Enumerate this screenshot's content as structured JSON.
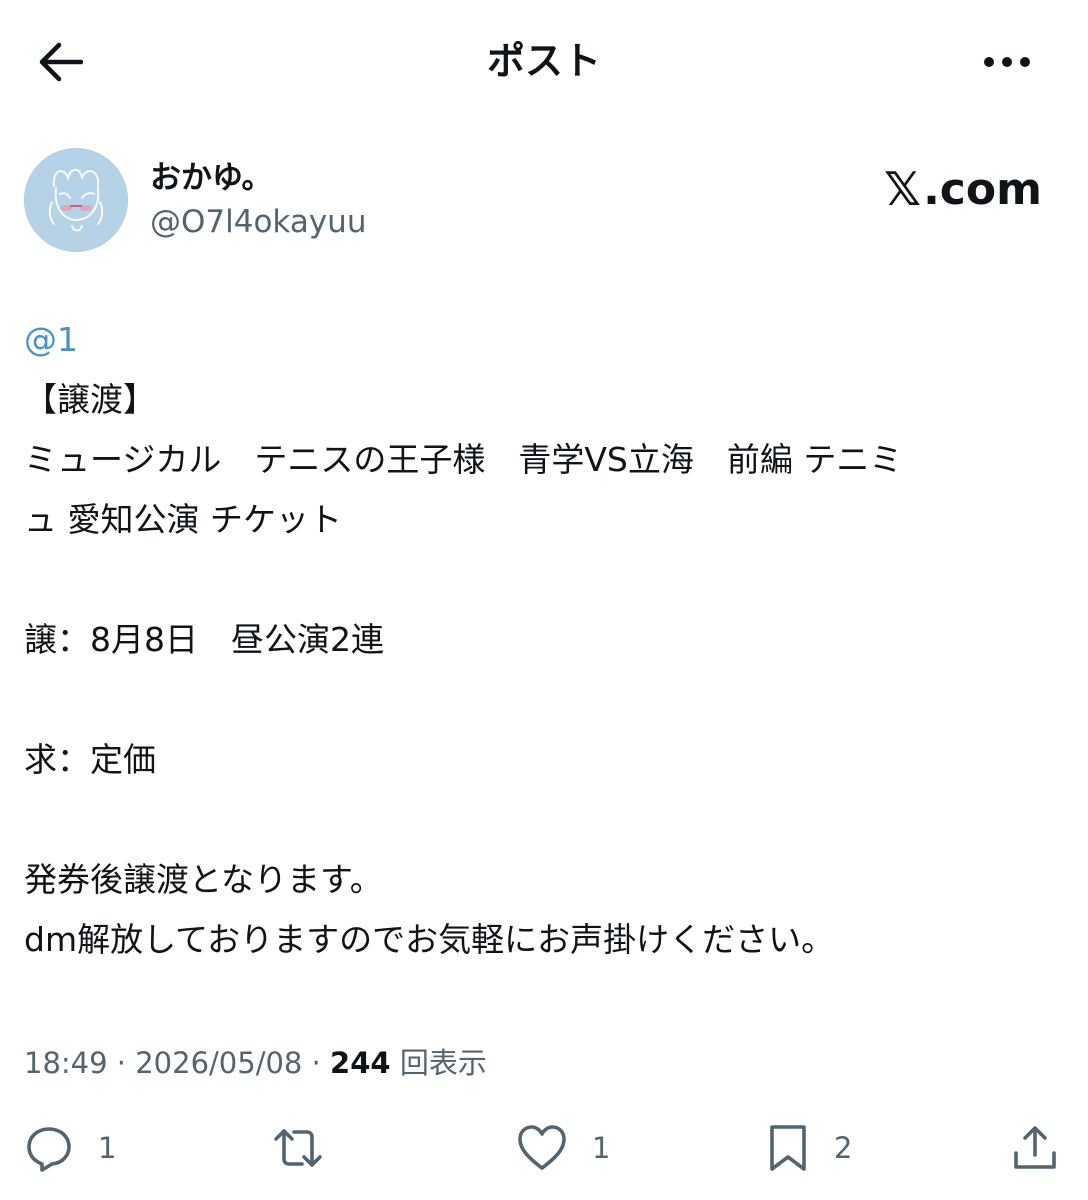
{
  "header": {
    "title": "ポスト",
    "back_icon": "arrow-left-icon",
    "more_icon": "more-horizontal-icon"
  },
  "author": {
    "display_name": "おかゆ。",
    "handle": "@O7l4okayuu",
    "avatar_color": "#b5d2e6"
  },
  "brand": {
    "glyph": "𝕏",
    "text": ".com"
  },
  "post": {
    "mention": "@1",
    "lines": [
      "【譲渡】",
      "ミュージカル　テニスの王子様　青学VS立海　前編 テニミ",
      "ュ 愛知公演 チケット",
      "",
      "譲：8月8日　昼公演2連",
      "",
      "求：定価",
      "",
      "発券後譲渡となります。",
      "dm解放しておりますのでお気軽にお声掛けください。"
    ]
  },
  "meta": {
    "time": "18:49",
    "separator": " · ",
    "date": "2026/05/08",
    "views_count": "244",
    "views_label": "回表示"
  },
  "actions": {
    "reply_count": "1",
    "repost_count": "",
    "like_count": "1",
    "bookmark_count": "2"
  },
  "colors": {
    "text": "#0f1419",
    "muted": "#536471",
    "link": "#4a90c9"
  }
}
